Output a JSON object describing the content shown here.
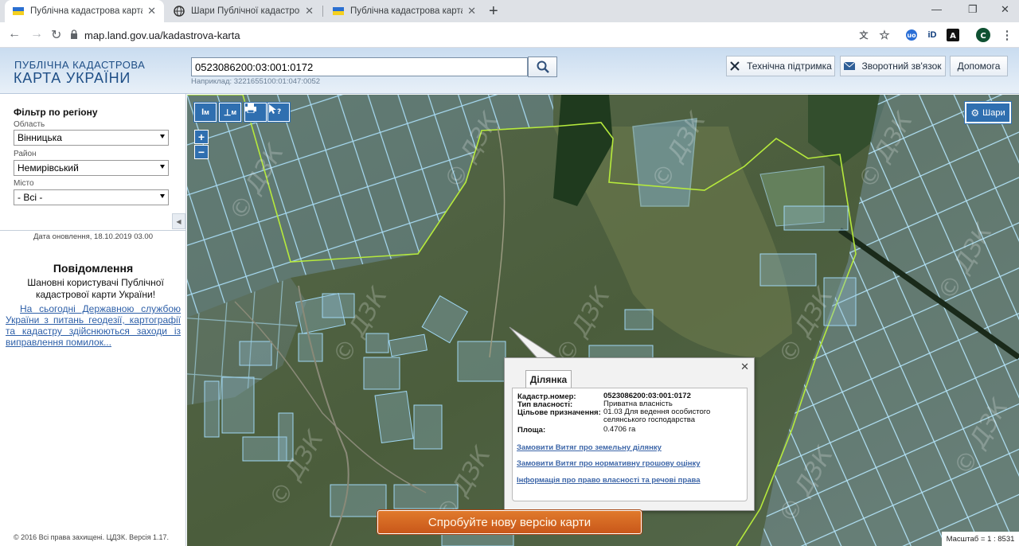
{
  "browser": {
    "tabs": [
      {
        "title": "Публічна кадастрова карта Укр"
      },
      {
        "title": "Шари Публічної кадастрової ка"
      },
      {
        "title": "Публічна кадастрова карта Укр"
      }
    ],
    "url": "map.land.gov.ua/kadastrova-karta",
    "profile_initial": "C"
  },
  "header": {
    "logo_line1": "ПУБЛІЧНА КАДАСТРОВА",
    "logo_line2": "КАРТА УКРАЇНИ",
    "search_value": "0523086200:03:001:0172",
    "example": "Наприклад: 3221655100:01:047:0052",
    "support_label": "Технічна підтримка",
    "feedback_label": "Зворотний зв'язок",
    "help_label": "Допомога"
  },
  "sidebar": {
    "filter_title": "Фільтр по регіону",
    "region_label": "Область",
    "region_value": "Вінницька",
    "district_label": "Район",
    "district_value": "Немирівський",
    "city_label": "Місто",
    "city_value": "- Всі -",
    "update_date": "Дата оновлення, 18.10.2019 03.00",
    "notice_title": "Повідомлення",
    "notice_greeting": "Шановні користувачі Публічної кадастрової карти України!",
    "notice_link": "На сьогодні Державною службою України з питань геодезії, картографії та кадастру здійснюються заходи із виправлення помилок...",
    "copyright": "© 2016 Всі права захищені. ЦДЗК. Версія 1.17."
  },
  "map": {
    "tool_ruler": "I",
    "tool_area": "⊥",
    "tool_sub": "м",
    "zoom_in": "+",
    "zoom_out": "−",
    "layers_label": "Шари",
    "scale_label": "Масштаб = 1 : 8531",
    "watermark": "© ДЗК",
    "new_version": "Спробуйте нову версію карти"
  },
  "popup": {
    "tab": "Ділянка",
    "rows": [
      {
        "k": "Кадастр.номер:",
        "v": "0523086200:03:001:0172"
      },
      {
        "k": "Тип власності:",
        "v": "Приватна власність"
      },
      {
        "k": "Цільове призначення:",
        "v": "01.03 Для ведення особистого селянського господарства"
      },
      {
        "k": "Площа:",
        "v": "0.4706 га"
      }
    ],
    "link1": "Замовити Витяг про земельну ділянку",
    "link2": "Замовити Витяг про нормативну грошову оцінку",
    "link3": "Інформація про право власності та речові права"
  }
}
